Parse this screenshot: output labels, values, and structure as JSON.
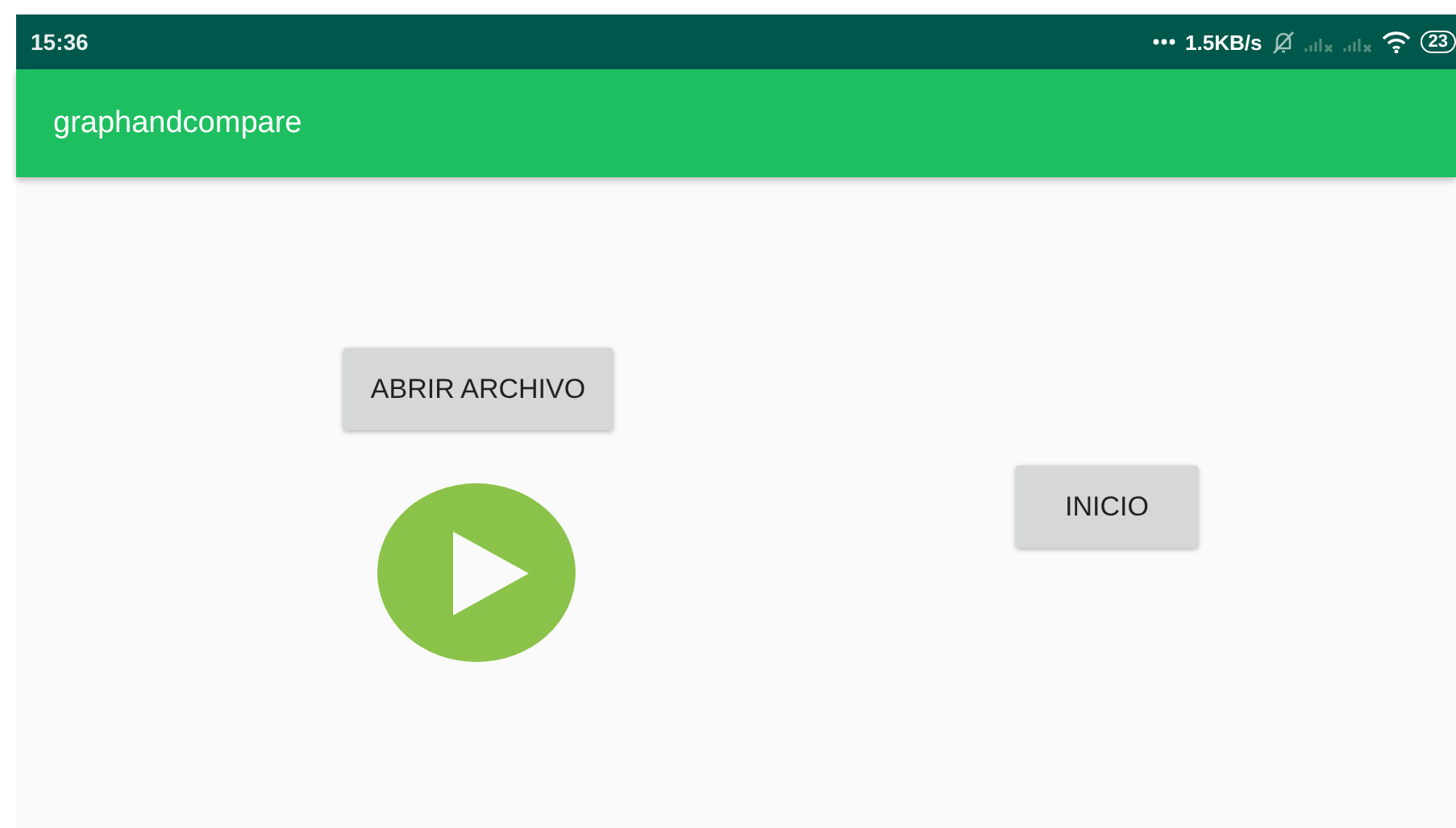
{
  "status_bar": {
    "time": "15:36",
    "network_speed": "1.5KB/s",
    "battery": "23"
  },
  "app_bar": {
    "title": "graphandcompare"
  },
  "buttons": [
    {
      "label": "ABRIR ARCHIVO"
    },
    {
      "label": "INICIO"
    }
  ]
}
